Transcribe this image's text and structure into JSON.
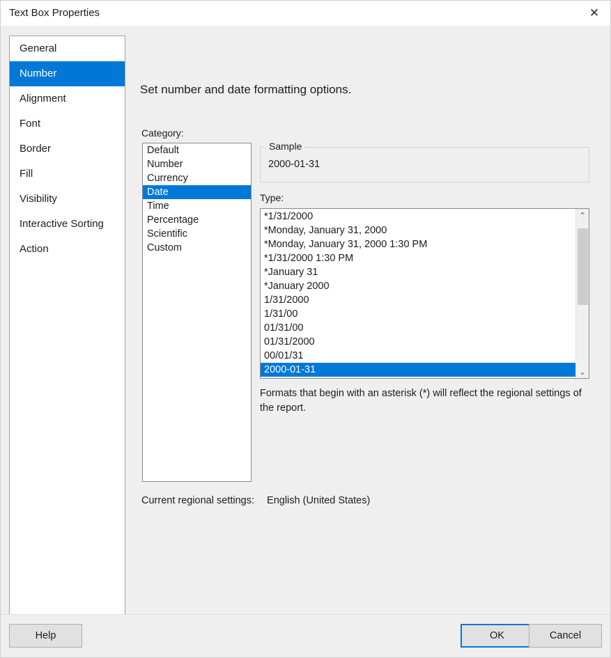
{
  "window": {
    "title": "Text Box Properties",
    "close_icon": "close-icon",
    "close_glyph": "✕"
  },
  "sidebar": {
    "items": [
      {
        "label": "General",
        "selected": false
      },
      {
        "label": "Number",
        "selected": true
      },
      {
        "label": "Alignment",
        "selected": false
      },
      {
        "label": "Font",
        "selected": false
      },
      {
        "label": "Border",
        "selected": false
      },
      {
        "label": "Fill",
        "selected": false
      },
      {
        "label": "Visibility",
        "selected": false
      },
      {
        "label": "Interactive Sorting",
        "selected": false
      },
      {
        "label": "Action",
        "selected": false
      }
    ]
  },
  "main": {
    "heading": "Set number and date formatting options.",
    "category": {
      "label": "Category:",
      "items": [
        {
          "label": "Default",
          "selected": false
        },
        {
          "label": "Number",
          "selected": false
        },
        {
          "label": "Currency",
          "selected": false
        },
        {
          "label": "Date",
          "selected": true
        },
        {
          "label": "Time",
          "selected": false
        },
        {
          "label": "Percentage",
          "selected": false
        },
        {
          "label": "Scientific",
          "selected": false
        },
        {
          "label": "Custom",
          "selected": false
        }
      ]
    },
    "sample": {
      "legend": "Sample",
      "value": "2000-01-31"
    },
    "type": {
      "label": "Type:",
      "items": [
        {
          "label": "*1/31/2000",
          "selected": false
        },
        {
          "label": "*Monday, January 31, 2000",
          "selected": false
        },
        {
          "label": "*Monday, January 31, 2000 1:30 PM",
          "selected": false
        },
        {
          "label": "*1/31/2000 1:30 PM",
          "selected": false
        },
        {
          "label": "*January 31",
          "selected": false
        },
        {
          "label": "*January 2000",
          "selected": false
        },
        {
          "label": "1/31/2000",
          "selected": false
        },
        {
          "label": "1/31/00",
          "selected": false
        },
        {
          "label": "01/31/00",
          "selected": false
        },
        {
          "label": "01/31/2000",
          "selected": false
        },
        {
          "label": "00/01/31",
          "selected": false
        },
        {
          "label": "2000-01-31",
          "selected": true
        }
      ],
      "scroll_up_glyph": "⌃",
      "scroll_down_glyph": "⌄"
    },
    "format_note": "Formats that begin with an asterisk (*) will reflect the regional settings of the report.",
    "regional": {
      "label": "Current regional settings:",
      "value": "English (United States)"
    }
  },
  "footer": {
    "help_label": "Help",
    "ok_label": "OK",
    "cancel_label": "Cancel"
  },
  "colors": {
    "accent": "#0078d7",
    "dialog_bg": "#efefef",
    "panel_bg": "#ffffff"
  }
}
